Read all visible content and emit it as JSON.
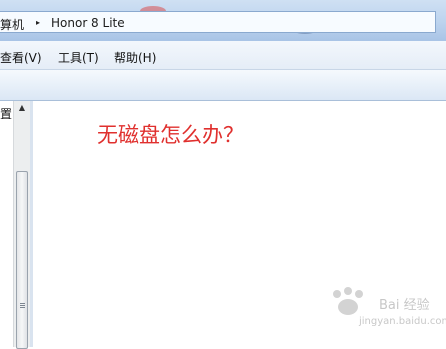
{
  "address_bar": {
    "segments": [
      "算机",
      "Honor 8 Lite"
    ],
    "separator": "▸"
  },
  "menubar": {
    "items": [
      "查看(V)",
      "工具(T)",
      "帮助(H)"
    ]
  },
  "nav_pane": {
    "partial_label": "置",
    "scroll_up_glyph": "▲"
  },
  "content": {
    "annotation": "无磁盘怎么办？",
    "annotation_color": "#e0302e"
  },
  "watermark": {
    "text": "Bai 经验",
    "url": "jingyan.baidu.com"
  }
}
